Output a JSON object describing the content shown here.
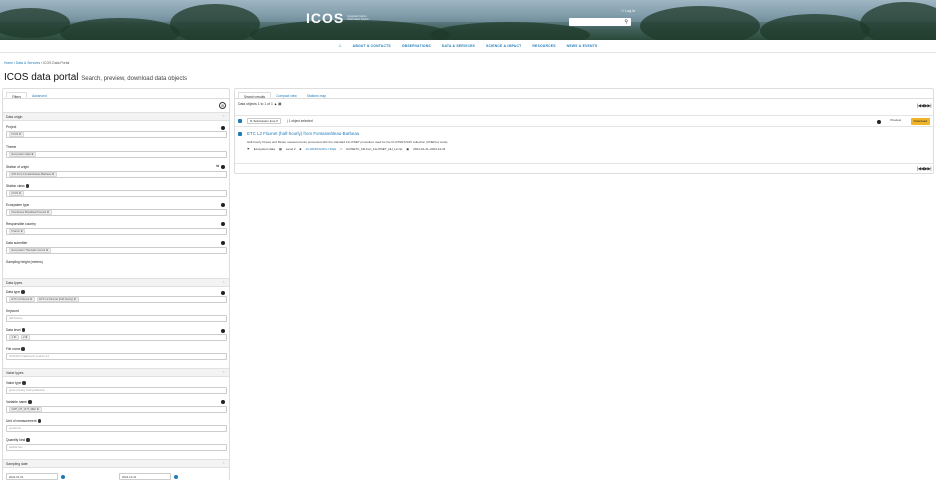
{
  "header": {
    "logo": "ICOS",
    "logo_tagline": "Integrated Carbon Observation System",
    "login": "Log in",
    "search_icon": "search-icon"
  },
  "nav": {
    "home_icon": "home-icon",
    "items": [
      "ABOUT & CONTACTS",
      "OBSERVATIONS",
      "DATA & SERVICES",
      "SCIENCE & IMPACT",
      "RESOURCES",
      "NEWS & EVENTS"
    ]
  },
  "breadcrumb": {
    "items": [
      "Home",
      "Data & Services",
      "ICOS Data Portal"
    ],
    "sep": "/"
  },
  "title": {
    "main": "ICOS data portal",
    "sub": "Search, preview, download data objects"
  },
  "left": {
    "tabs": [
      "Filters",
      "Advanced"
    ],
    "sections": {
      "data_origin": "Data origin",
      "data_types": "Data types",
      "value_types": "Value types",
      "sampling_date": "Sampling date"
    },
    "filters": {
      "project": {
        "label": "Project",
        "chips": [
          "ICOS"
        ]
      },
      "theme": {
        "label": "Theme",
        "chips": [
          "Ecosystem data"
        ]
      },
      "station": {
        "label": "Station of origin",
        "chips": [
          "(FR-Fon) Fontainebleau-Barbeau"
        ]
      },
      "station_class": {
        "label": "Station class",
        "chips": [
          "ICOS"
        ]
      },
      "ecosystem": {
        "label": "Ecosystem type",
        "chips": [
          "Deciduous Broadleaf Forests"
        ]
      },
      "responsible": {
        "label": "Responsible country",
        "chips": [
          "France"
        ]
      },
      "data_submitter": {
        "label": "Data submitter",
        "chips": [
          "Ecosystem Thematic Centre"
        ]
      },
      "sampling_height": {
        "label": "Sampling height (meters)"
      },
      "data_type": {
        "label": "Data type",
        "chips": [
          "ETC L2 Fluxes",
          "ETC L2 Fluxnet (half-hourly)"
        ]
      },
      "keyword": {
        "label": "Keyword",
        "placeholder": "(all) breezy"
      },
      "data_level": {
        "label": "Data level",
        "chips": [
          "1",
          "2"
        ]
      },
      "file_name": {
        "label": "File name",
        "placeholder": "ICOS ETC half-hourly product 2.0"
      },
      "value_type": {
        "label": "Value type",
        "placeholder": "gross primary CO2 production"
      },
      "variable_name": {
        "label": "Variable name",
        "chips": [
          "GPP_NT_VUT_REF"
        ]
      },
      "unit": {
        "label": "Unit of measurement",
        "placeholder": "µmol/m²/s"
      },
      "quantity_kind": {
        "label": "Quantity kind",
        "placeholder": "particle flux"
      }
    },
    "dates": {
      "from": "2024-01-01",
      "to": "2024-12-31"
    }
  },
  "right": {
    "tabs": [
      "Search results",
      "Compact view",
      "Stations map"
    ],
    "count": "Data objects 1 to 1 of 1",
    "sort_label": "Submission time",
    "selection": "1 object selected",
    "preview": "Preview",
    "download": "Download",
    "pager": "|◀◀ ▶▶|",
    "result": {
      "title": "ETC L2 Fluxnet (half-hourly) from Fontainebleau-Barbeau",
      "description": "Half-hourly Fluxes and Meteo measurements processed with the standard FLUXNET procedure used for the FLUXNET2015 collection (ONEFlux suite).",
      "theme": "Ecosystem data",
      "level": "Level 2",
      "link": "10.18160/G6FN-YDQE",
      "filename": "ICOSETC_FR-Fon_FLUXNET_HH_L2.zip",
      "period": "2024-01-31–2024-12-31"
    }
  }
}
